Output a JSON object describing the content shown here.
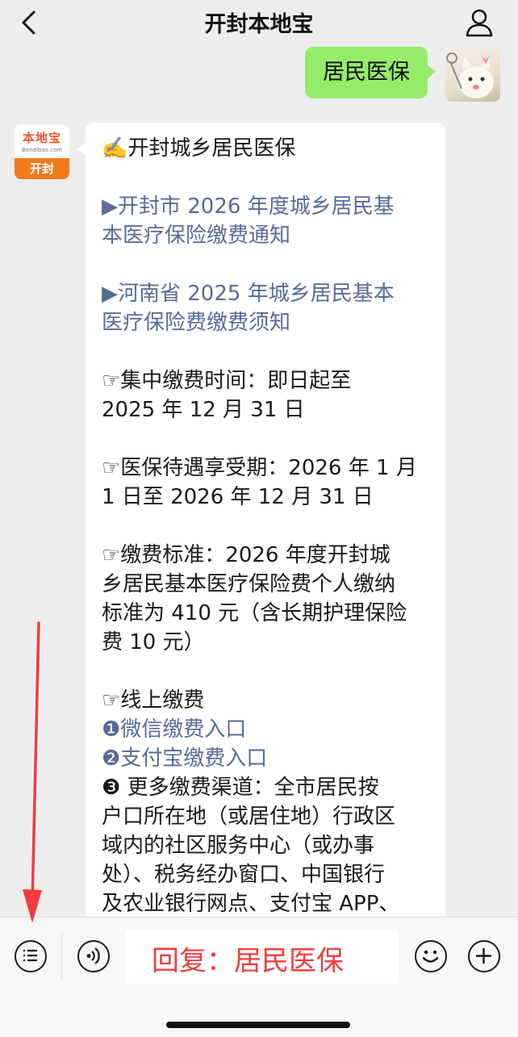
{
  "header": {
    "title": "开封本地宝",
    "back_icon": "chevron-left-icon",
    "profile_icon": "person-icon"
  },
  "my_message": {
    "text": "居民医保"
  },
  "sender_avatar": {
    "brand": "本地宝",
    "url": "Bendibao.com",
    "city": "开封"
  },
  "reply_message": {
    "lines": [
      {
        "text": "✍️开封城乡居民医保",
        "link": false
      },
      {
        "text": "",
        "link": false
      },
      {
        "text": "▶开封市 2026 年度城乡居民基",
        "link": true
      },
      {
        "text": "本医疗保险缴费通知",
        "link": true
      },
      {
        "text": "",
        "link": false
      },
      {
        "text": "▶河南省 2025 年城乡居民基本",
        "link": true
      },
      {
        "text": "医疗保险费缴费须知",
        "link": true
      },
      {
        "text": "",
        "link": false
      },
      {
        "text": "☞集中缴费时间：即日起至",
        "link": false
      },
      {
        "text": "2025 年 12 月 31 日",
        "link": false
      },
      {
        "text": "",
        "link": false
      },
      {
        "text": "☞医保待遇享受期：2026 年 1 月",
        "link": false
      },
      {
        "text": "1 日至 2026 年 12 月 31 日",
        "link": false
      },
      {
        "text": "",
        "link": false
      },
      {
        "text": "☞缴费标准：2026 年度开封城",
        "link": false
      },
      {
        "text": "乡居民基本医疗保险费个人缴纳",
        "link": false
      },
      {
        "text": "标准为 410 元（含长期护理保险",
        "link": false
      },
      {
        "text": "费 10 元）",
        "link": false
      },
      {
        "text": "",
        "link": false
      },
      {
        "text": "☞线上缴费",
        "link": false
      },
      {
        "text": "❶微信缴费入口",
        "link": true
      },
      {
        "text": "❷支付宝缴费入口",
        "link": true
      },
      {
        "text": "❸ 更多缴费渠道：全市居民按",
        "link": false
      },
      {
        "text": "户口所在地（或居住地）行政区",
        "link": false
      },
      {
        "text": "域内的社区服务中心（或办事",
        "link": false
      },
      {
        "text": "处）、税务经办窗口、中国银行",
        "link": false
      },
      {
        "text": "及农业银行网点、支付宝 APP、",
        "link": false
      }
    ]
  },
  "input_bar": {
    "menu_icon": "menu-list-icon",
    "voice_icon": "voice-icon",
    "reply_text": "回复：居民医保",
    "emoji_icon": "emoji-icon",
    "plus_icon": "plus-icon"
  },
  "colors": {
    "my_bubble": "#95ec69",
    "link": "#576b95",
    "annotation_red": "#f03c3c",
    "brand_orange": "#f07a1c"
  }
}
